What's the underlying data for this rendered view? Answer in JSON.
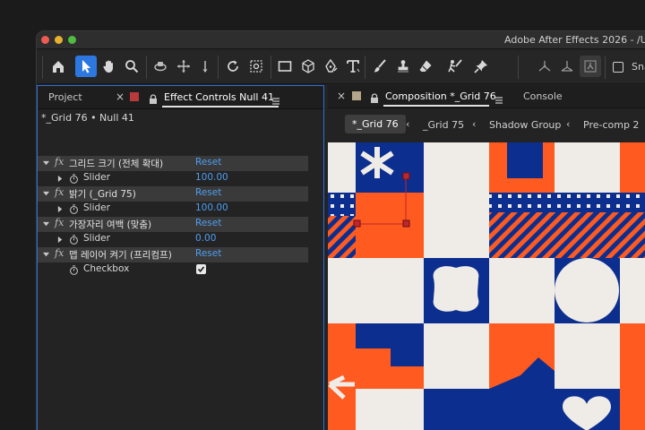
{
  "window": {
    "title": "Adobe After Effects 2026 - /U"
  },
  "toolbar": {
    "tools": [
      "home-icon",
      "selection-arrow-icon",
      "hand-icon",
      "zoom-icon",
      "orbit-camera-icon",
      "pan-camera-icon",
      "dolly-camera-icon",
      "rotate-icon",
      "pan-behind-icon",
      "rectangle-icon",
      "cube-icon",
      "pen-icon",
      "type-icon",
      "brush-icon",
      "clone-stamp-icon",
      "eraser-icon",
      "roto-brush-icon",
      "puppet-pin-icon",
      "axis-local-icon",
      "axis-world-icon",
      "axis-view-icon"
    ],
    "snap_label": "Snap",
    "snap_checked": false
  },
  "left_panel": {
    "tabs": {
      "project": "Project",
      "effect_controls": "Effect Controls Null 41"
    },
    "header": "*_Grid 76 • Null 41",
    "effects": [
      {
        "name": "그리드 크기 (전체 확대)",
        "reset": "Reset",
        "prop": "Slider",
        "value": "100.00"
      },
      {
        "name": "밝기 (_Grid 75)",
        "reset": "Reset",
        "prop": "Slider",
        "value": "100.00"
      },
      {
        "name": "가장자리 여백 (맞춤)",
        "reset": "Reset",
        "prop": "Slider",
        "value": "0.00"
      },
      {
        "name": "맵 레이어 켜기 (프리컴프)",
        "reset": "Reset",
        "prop": "Checkbox",
        "checked": true
      }
    ]
  },
  "right_panel": {
    "tabs": {
      "composition": "Composition *_Grid 76",
      "console": "Console"
    },
    "breadcrumbs": [
      "*_Grid 76",
      "_Grid 75",
      "Shadow Group",
      "Pre-comp 2"
    ]
  },
  "colors": {
    "accent": "#2d78e0",
    "link": "#4f9df0",
    "orange": "#ff5a1f",
    "blue": "#0c2f8f",
    "cream": "#efebe7",
    "swatch_red": "#b83a3a",
    "swatch_tan": "#b5a58a"
  }
}
